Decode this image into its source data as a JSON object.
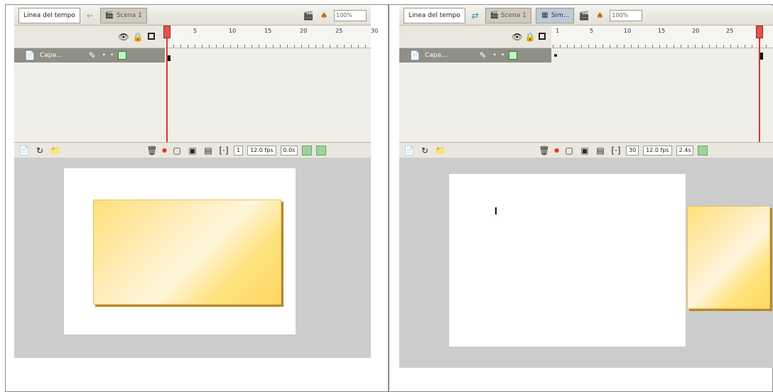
{
  "left_panel": {
    "tabs": [
      {
        "label": "Linea del tempo"
      },
      {
        "label": "Scena 1"
      }
    ],
    "zoom": "100%",
    "layer": {
      "name": "Capa..."
    },
    "ruler_labels": [
      "5",
      "10",
      "15",
      "20",
      "25",
      "30"
    ],
    "status": {
      "frame": "1",
      "fps": "12.0 fps",
      "time": "0.0s"
    }
  },
  "right_panel": {
    "tabs": [
      {
        "label": "Linea del tempo"
      },
      {
        "label": "Scena 1"
      },
      {
        "label": "Sim..."
      }
    ],
    "zoom": "100%",
    "layer": {
      "name": "Capa..."
    },
    "ruler_labels": [
      "1",
      "5",
      "10",
      "15",
      "20",
      "25"
    ],
    "status": {
      "frame": "30",
      "fps": "12.0 fps",
      "time": "2.4s"
    }
  },
  "colors": {
    "shape_fill": "#ffe07a",
    "playhead": "#e1342c",
    "stage_bg": "#cccccc"
  }
}
